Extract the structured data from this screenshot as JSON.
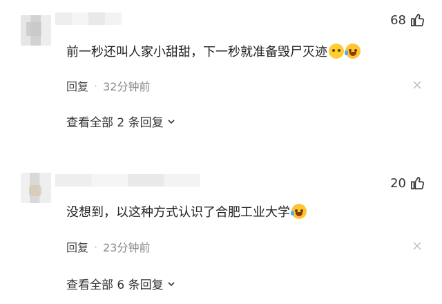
{
  "comments": [
    {
      "likes": "68",
      "text": "前一秒还叫人家小甜甜，下一秒就准备毁尸灭迹",
      "emojis": [
        "cover-face-emoji-icon",
        "laughing-crying-emoji-icon"
      ],
      "reply_label": "回复",
      "separator": "·",
      "time": "32分钟前",
      "view_replies": "查看全部 2 条回复"
    },
    {
      "likes": "20",
      "text": "没想到，以这种方式认识了合肥工业大学",
      "emojis": [
        "laughing-crying-emoji-icon"
      ],
      "reply_label": "回复",
      "separator": "·",
      "time": "23分钟前",
      "view_replies": "查看全部 6 条回复"
    }
  ],
  "icons": {
    "like": "thumbs-up-icon",
    "close": "close-icon",
    "expand": "chevron-down-icon"
  },
  "colors": {
    "text": "#222222",
    "meta": "#888888",
    "emoji": "#ffcc33"
  }
}
